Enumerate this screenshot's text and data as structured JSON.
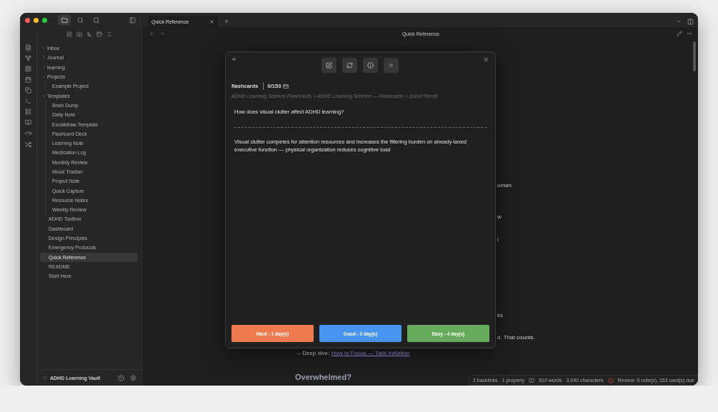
{
  "sidebar_tabs": [
    {
      "kind": "files",
      "selected": true
    },
    {
      "kind": "search",
      "selected": false
    },
    {
      "kind": "bookmarks",
      "selected": false
    }
  ],
  "tab": {
    "label": "Quick Reference",
    "selected": true
  },
  "ribbon": {
    "templater_label": "<%"
  },
  "file_tree": [
    {
      "kind": "folder",
      "name": "Inbox",
      "expanded": true,
      "selected": false
    },
    {
      "kind": "folder",
      "name": "Journal",
      "expanded": false,
      "selected": false
    },
    {
      "kind": "folder",
      "name": "learning",
      "expanded": false,
      "selected": false
    },
    {
      "kind": "folder",
      "name": "Projects",
      "expanded": true,
      "selected": false,
      "children": [
        {
          "kind": "file",
          "name": "Example Project",
          "selected": false
        }
      ]
    },
    {
      "kind": "folder",
      "name": "Templates",
      "expanded": true,
      "selected": false,
      "children": [
        {
          "kind": "file",
          "name": "Brain Dump",
          "selected": false
        },
        {
          "kind": "file",
          "name": "Daily Note",
          "selected": false
        },
        {
          "kind": "file",
          "name": "Excalidraw Template",
          "selected": false
        },
        {
          "kind": "file",
          "name": "Flashcard Deck",
          "selected": false
        },
        {
          "kind": "file",
          "name": "Learning Note",
          "selected": false
        },
        {
          "kind": "file",
          "name": "Medication Log",
          "selected": false
        },
        {
          "kind": "file",
          "name": "Monthly Review",
          "selected": false
        },
        {
          "kind": "file",
          "name": "Mood Tracker",
          "selected": false
        },
        {
          "kind": "file",
          "name": "Project Note",
          "selected": false
        },
        {
          "kind": "file",
          "name": "Quick Capture",
          "selected": false
        },
        {
          "kind": "file",
          "name": "Resource Notes",
          "selected": false
        },
        {
          "kind": "file",
          "name": "Weekly Review",
          "selected": false
        }
      ]
    },
    {
      "kind": "file",
      "name": "ADHD Toolbox",
      "selected": false
    },
    {
      "kind": "file",
      "name": "Dashboard",
      "selected": false
    },
    {
      "kind": "file",
      "name": "Design Principles",
      "selected": false
    },
    {
      "kind": "file",
      "name": "Emergency Protocols",
      "selected": false
    },
    {
      "kind": "file",
      "name": "Quick Reference",
      "selected": true
    },
    {
      "kind": "file",
      "name": "README",
      "selected": false
    },
    {
      "kind": "file",
      "name": "Start Here",
      "selected": false
    }
  ],
  "vault": {
    "name": "ADHD Learning Vault"
  },
  "header": {
    "title": "Quick Reference"
  },
  "editor": {
    "lines": [
      {
        "kind": "fragment",
        "text": "uman"
      },
      {
        "kind": "fragment",
        "text": "w"
      },
      {
        "kind": "fragment",
        "text": "i"
      },
      {
        "kind": "fragment",
        "text": "ks"
      },
      {
        "kind": "fragment",
        "text": "d. That counts."
      },
      {
        "kind": "link_line",
        "prefix": "→ Deep dive: ",
        "link": "How to Focus — Task Initiation"
      },
      {
        "kind": "heading",
        "text": "Overwhelmed?"
      }
    ]
  },
  "flashcard_modal": {
    "deck": "flashcards",
    "count": "0/153",
    "breadcrumb": "ADHD Learning Science Flashcards > ADHD Learning Science — Flashcards > Quick Recall",
    "question": "How does visual clutter affect ADHD learning?",
    "answer": "Visual clutter competes for attention resources and increases the filtering burden on already-taxed executive function — physical organization reduces cognitive load",
    "buttons": [
      {
        "label": "Hard - 1 day(s)",
        "color": "#ef7b4f"
      },
      {
        "label": "Good - 3 day(s)",
        "color": "#4894ef"
      },
      {
        "label": "Easy - 4 day(s)",
        "color": "#66ab5b"
      }
    ]
  },
  "status_bar": {
    "items": [
      {
        "kind": "text",
        "text": "2 backlinks"
      },
      {
        "kind": "text",
        "text": "1 property"
      },
      {
        "kind": "reading"
      },
      {
        "kind": "text",
        "text": "510 words"
      },
      {
        "kind": "text",
        "text": "3,040 characters"
      },
      {
        "kind": "review_icon"
      },
      {
        "kind": "text",
        "text": "Review: 0 note(s), 153 card(s) due"
      }
    ]
  }
}
